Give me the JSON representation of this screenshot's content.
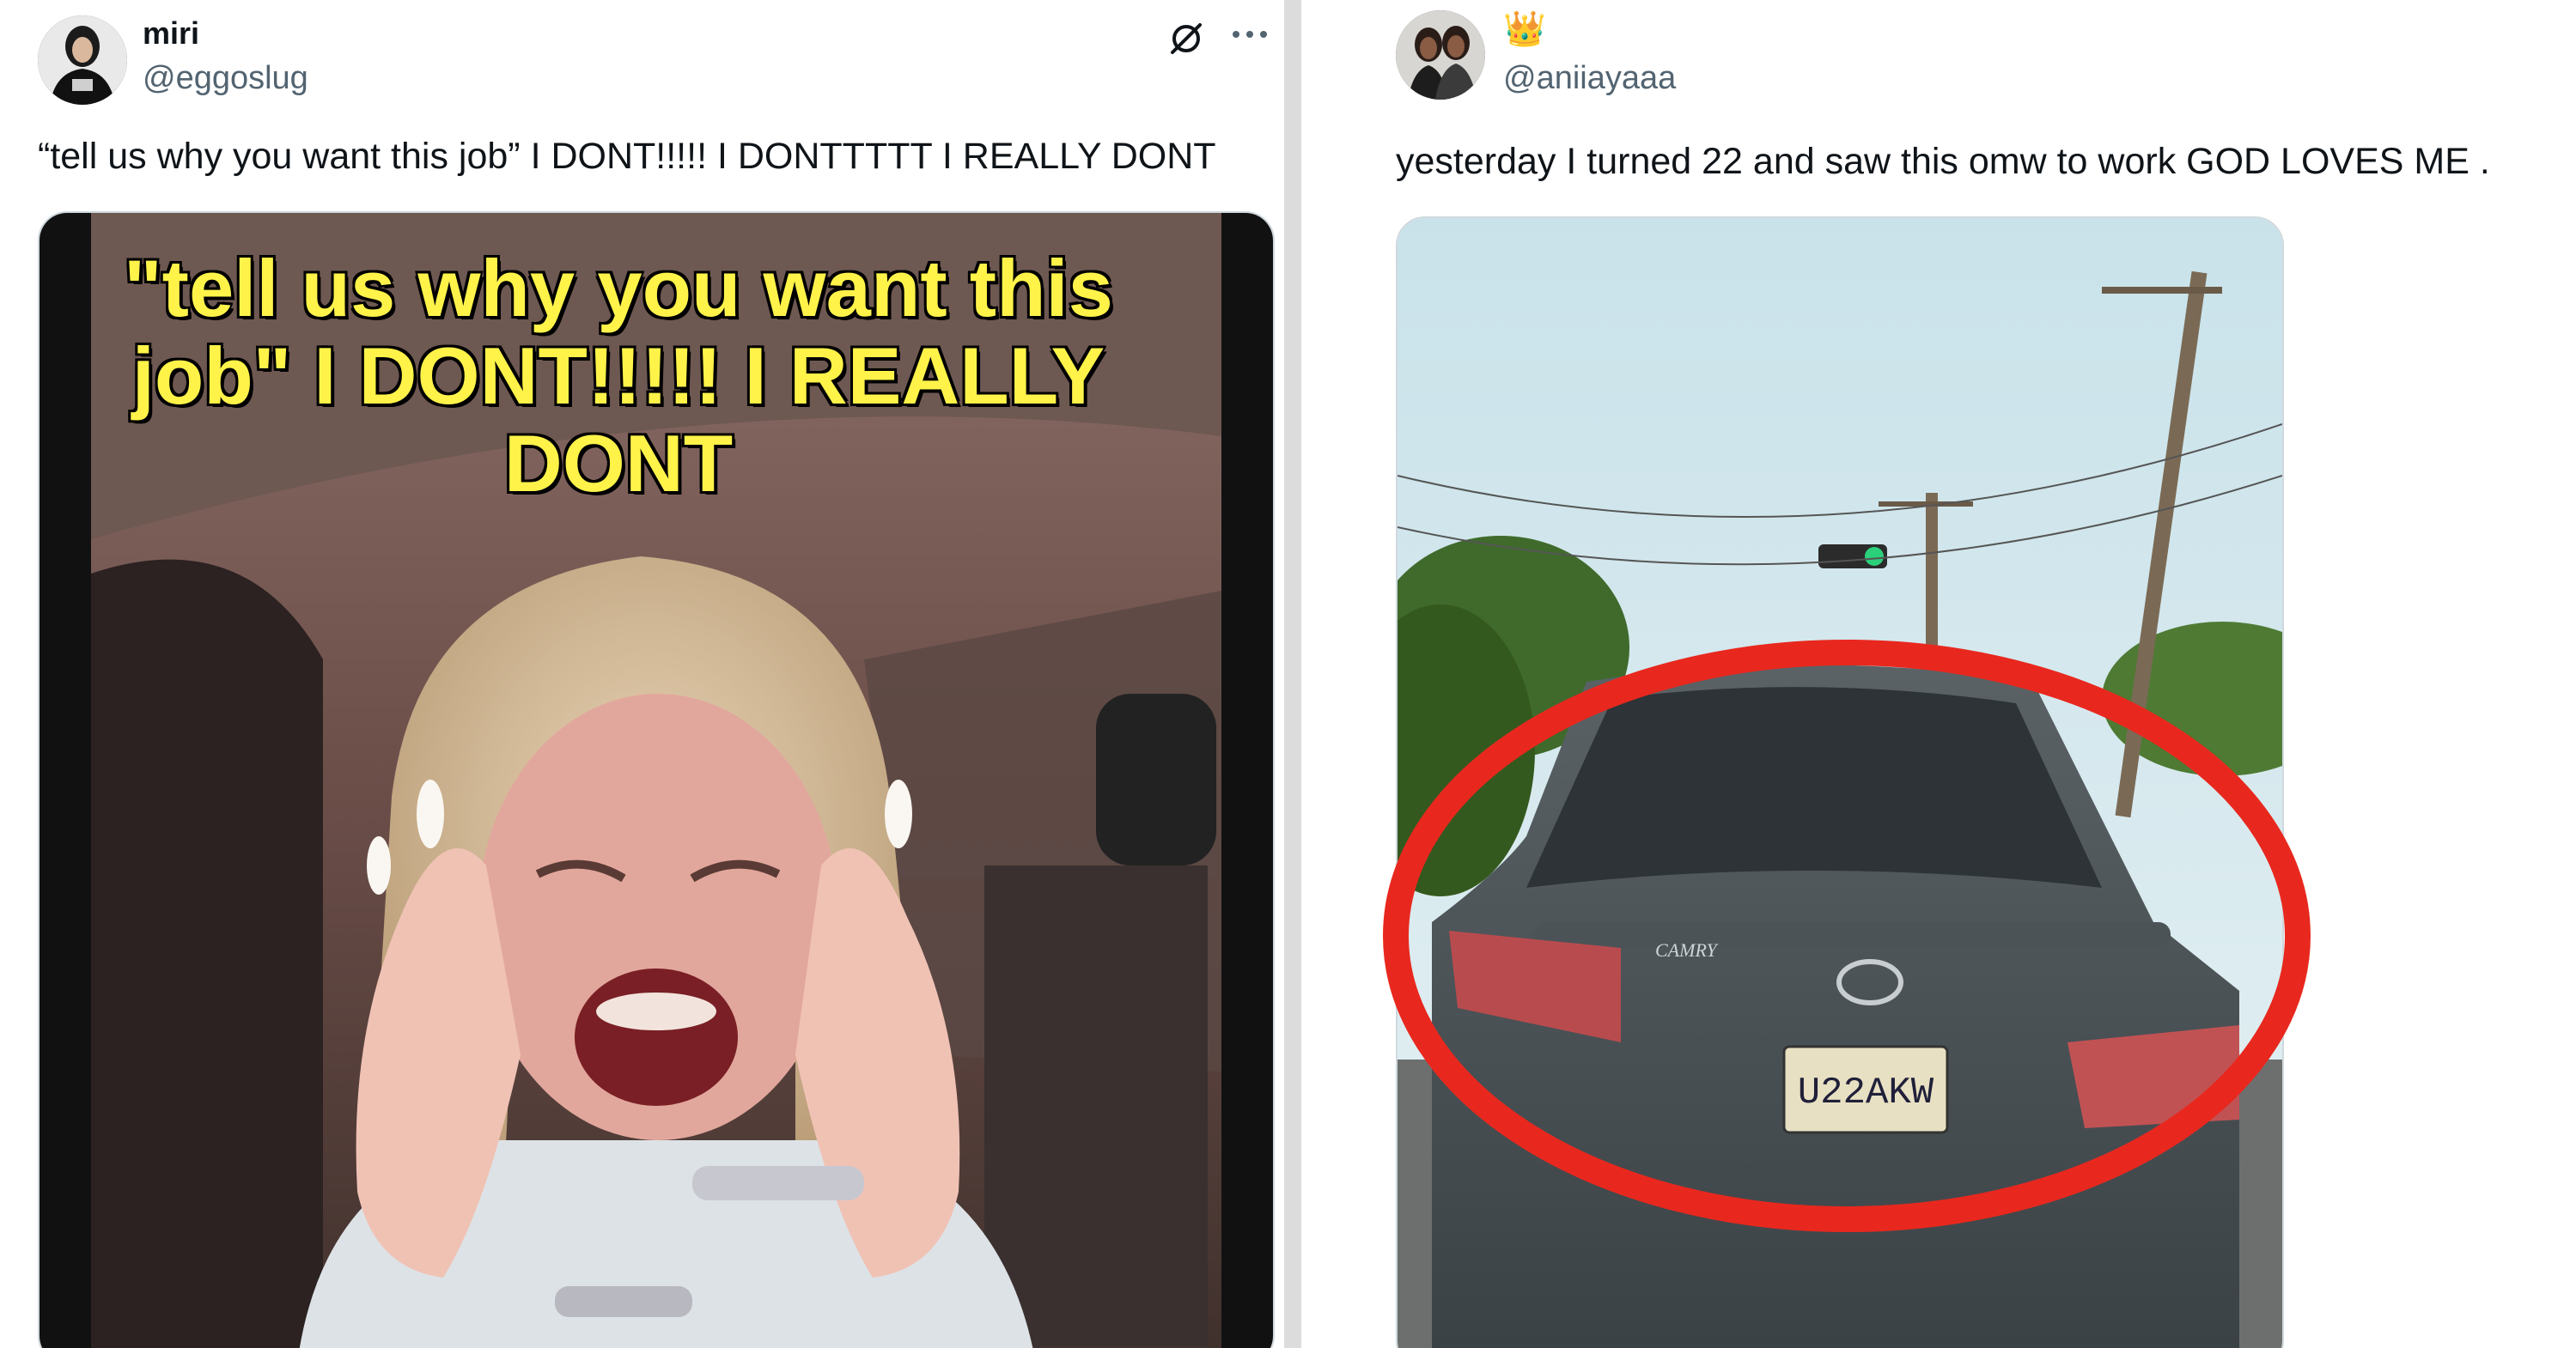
{
  "tweets": [
    {
      "name": "miri",
      "handle": "@eggoslug",
      "text": "“tell us why you want this job” I DONT!!!!! I DONTTTTT I REALLY DONT",
      "media_caption": "\"tell us why you want this job\" I DONT!!!!! I REALLY DONT",
      "icons": [
        "grok-icon",
        "more-icon"
      ]
    },
    {
      "name_emoji": "👑",
      "handle": "@aniiayaaa",
      "text": "yesterday I turned 22 and saw this omw to work GOD LOVES ME .",
      "media": {
        "license_plate": "U22AKW",
        "car_model": "CAMRY",
        "highlight_color": "#e8281e"
      }
    }
  ],
  "colors": {
    "text": "#0f1419",
    "secondary": "#536471",
    "caption": "#fff34a"
  }
}
